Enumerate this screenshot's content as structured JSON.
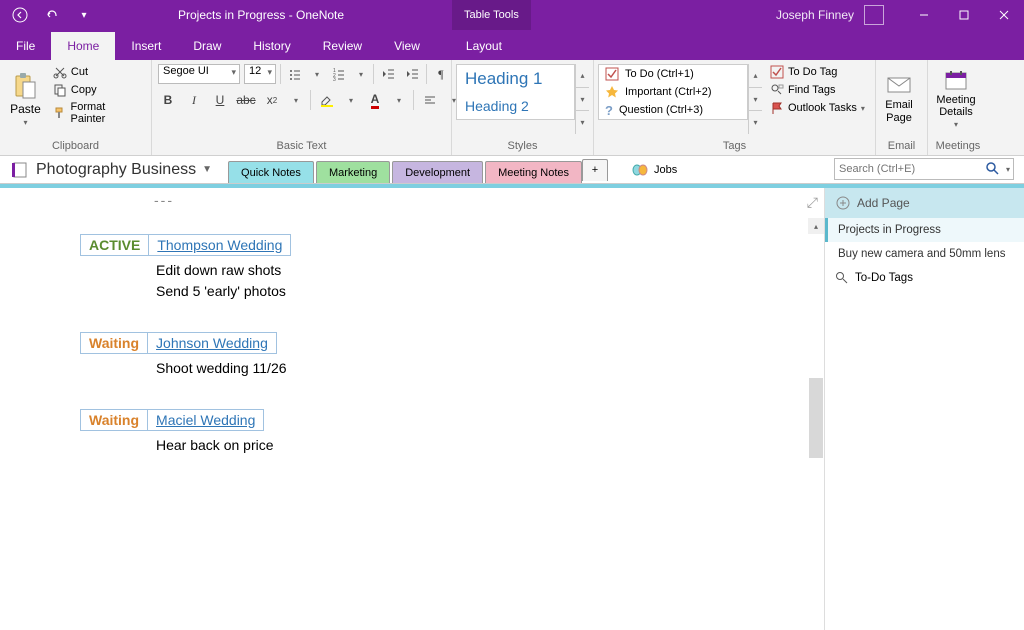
{
  "titlebar": {
    "title": "Projects in Progress  -  OneNote",
    "tableTools": "Table Tools",
    "user": "Joseph Finney"
  },
  "menu": {
    "file": "File",
    "home": "Home",
    "insert": "Insert",
    "draw": "Draw",
    "history": "History",
    "review": "Review",
    "view": "View",
    "layout": "Layout"
  },
  "ribbon": {
    "clipboard": {
      "label": "Clipboard",
      "paste": "Paste",
      "cut": "Cut",
      "copy": "Copy",
      "formatPainter": "Format Painter"
    },
    "basicText": {
      "label": "Basic Text",
      "font": "Segoe UI",
      "size": "12"
    },
    "styles": {
      "label": "Styles",
      "h1": "Heading 1",
      "h2": "Heading 2"
    },
    "tags": {
      "label": "Tags",
      "items": [
        {
          "label": "To Do (Ctrl+1)"
        },
        {
          "label": "Important (Ctrl+2)"
        },
        {
          "label": "Question (Ctrl+3)"
        }
      ],
      "toDoTag": "To Do Tag",
      "findTags": "Find Tags",
      "outlookTasks": "Outlook Tasks"
    },
    "email": {
      "label": "Email",
      "btn": "Email Page"
    },
    "meetings": {
      "label": "Meetings",
      "btn": "Meeting Details"
    }
  },
  "notebook": {
    "name": "Photography Business",
    "sections": [
      {
        "label": "Quick Notes",
        "bg": "#96e0e8",
        "active": true
      },
      {
        "label": "Marketing",
        "bg": "#9fe09f"
      },
      {
        "label": "Development",
        "bg": "#c6b6e0"
      },
      {
        "label": "Meeting Notes",
        "bg": "#f2b6c4"
      }
    ],
    "jobs": "Jobs"
  },
  "search": {
    "placeholder": "Search (Ctrl+E)"
  },
  "pagePane": {
    "addPage": "Add Page",
    "pages": [
      {
        "label": "Projects in Progress",
        "active": true
      },
      {
        "label": "Buy new camera and 50mm lens"
      }
    ],
    "toDoTags": "To-Do Tags"
  },
  "content": {
    "dashes": "---",
    "projects": [
      {
        "status": "ACTIVE",
        "statusClass": "status-active",
        "name": "Thompson Wedding",
        "tasks": [
          "Edit down raw shots",
          "Send 5 'early' photos"
        ]
      },
      {
        "status": "Waiting",
        "statusClass": "status-wait",
        "name": "Johnson Wedding",
        "tasks": [
          "Shoot wedding 11/26"
        ]
      },
      {
        "status": "Waiting",
        "statusClass": "status-wait",
        "name": "Maciel  Wedding",
        "tasks": [
          "Hear back on price"
        ]
      }
    ]
  }
}
